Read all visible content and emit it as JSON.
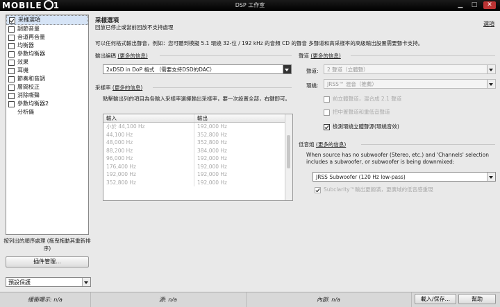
{
  "titlebar": {
    "title": "DSP 工作室",
    "logo_text": "MOBILE"
  },
  "sidebar": {
    "items": [
      {
        "label": "采樣選項",
        "checked": true,
        "selected": true,
        "has_box": true
      },
      {
        "label": "調節音量",
        "checked": false,
        "selected": false,
        "has_box": true
      },
      {
        "label": "音道再音量",
        "checked": false,
        "selected": false,
        "has_box": true
      },
      {
        "label": "均衡器",
        "checked": false,
        "selected": false,
        "has_box": true
      },
      {
        "label": "參數均衡器",
        "checked": false,
        "selected": false,
        "has_box": true
      },
      {
        "label": "效果",
        "checked": false,
        "selected": false,
        "has_box": true
      },
      {
        "label": "耳機",
        "checked": false,
        "selected": false,
        "has_box": true
      },
      {
        "label": "節奏和音調",
        "checked": false,
        "selected": false,
        "has_box": true
      },
      {
        "label": "層間校正",
        "checked": false,
        "selected": false,
        "has_box": true
      },
      {
        "label": "消除嘶聲",
        "checked": false,
        "selected": false,
        "has_box": true
      },
      {
        "label": "參數均衡器2",
        "checked": false,
        "selected": false,
        "has_box": true
      },
      {
        "label": "分析儀",
        "checked": false,
        "selected": false,
        "has_box": false
      }
    ],
    "note": "按列出的順序處理 (拖曳拖動其重新排序)",
    "plugin_button": "插件管理...",
    "preset_value": "預設保護"
  },
  "panel": {
    "title": "采樣選項",
    "subtitle": "回放已停止或當前回放不支持處理",
    "help": "選項",
    "description": "可以任何格式輸出聲音，例如：您可聽到模擬 5.1 環繞 32-位 / 192 kHz 的音頻 CD 的聲音 多聲道和高采樣率的高級輸出設置需要聲卡支持。",
    "output_format": {
      "label": "輸出編碼",
      "link": "(更多的信息)",
      "value": "2xDSD in DoP 格式 （需要支持DSD的DAC）"
    },
    "sample_rate": {
      "label": "采樣率",
      "link": "(更多的信息)",
      "hint": "點擊輸出列的項目為各輸入采樣率選擇輸出采樣率，要一次設置全部，右鍵即可。",
      "col_in": "輸入",
      "col_out": "輸出",
      "rows": [
        {
          "in": "小於 44,100 Hz",
          "out": "192,000 Hz"
        },
        {
          "in": "44,100 Hz",
          "out": "352,800 Hz"
        },
        {
          "in": "48,000 Hz",
          "out": "352,800 Hz"
        },
        {
          "in": "88,200 Hz",
          "out": "384,000 Hz"
        },
        {
          "in": "96,000 Hz",
          "out": "192,000 Hz"
        },
        {
          "in": "176,400 Hz",
          "out": "192,000 Hz"
        },
        {
          "in": "192,000 Hz",
          "out": "192,000 Hz"
        },
        {
          "in": "352,800 Hz",
          "out": "192,000 Hz"
        }
      ]
    },
    "channels": {
      "label": "聲道",
      "link": "(更多的信息)",
      "ch_label": "聲道:",
      "ch_value": "2 聲道（立體聲）",
      "mode_label": "環繞:",
      "mode_value": "JRSS™ 混音（推薦）",
      "opt1": "前立體聲道，混合成 2.1 聲道",
      "opt2": "把中置聲道和重低音聲道",
      "opt3": "檢測環繞立體聲源(環繞音效)"
    },
    "lowfreq": {
      "label": "低音炮",
      "link": "(更多的信息)",
      "desc": "When source has no subwoofer (Stereo, etc.) and 'Channels' selection includes a subwoofer, or subwoofer is being downmixed:",
      "value": "JRSS Subwoofer (120 Hz low-pass)",
      "opt": "Subclarity™輸出更飽滿，更廣域的低音感重現"
    }
  },
  "status": {
    "latency": "緩衝曝示: n/a",
    "source": "源: n/a",
    "internal": "內部: n/a",
    "load_save": "載入/保存...",
    "help": "幫助"
  }
}
